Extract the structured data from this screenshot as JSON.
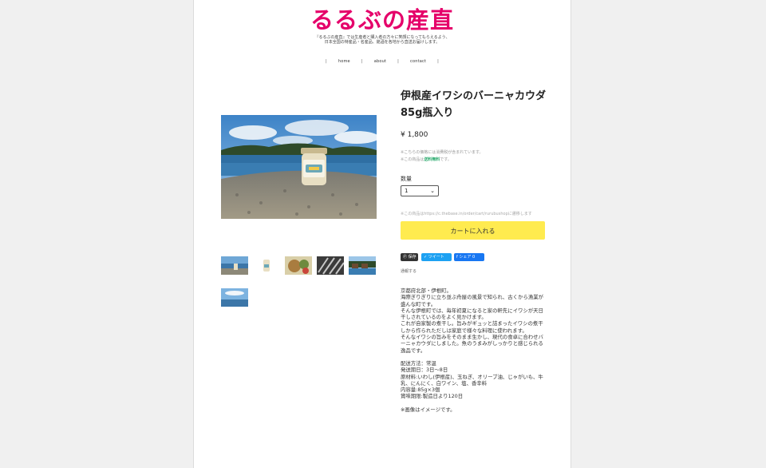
{
  "header": {
    "logo_part1": "るるぶ",
    "logo_part2": "の産直",
    "tagline_line1": "『るるぶの産直』では生産者と購入者の方々に笑顔になってもらえるよう、",
    "tagline_line2": "日本全国の特産品・名産品、銘酒を各地から直送お届けします。"
  },
  "nav": {
    "sep": "|",
    "items": [
      "home",
      "about",
      "contact"
    ]
  },
  "product": {
    "title": "伊根産イワシのバーニャカウダ　85g瓶入り",
    "price": "¥ 1,800",
    "note_tax": "※こちらの価格には消費税が含まれています。",
    "note_ship_prefix": "※この商品は",
    "note_ship_highlight": "送料無料",
    "note_ship_suffix": "です。",
    "qty_label": "数量",
    "qty_value": "1",
    "url_note": "※この商品はhttps://c.thebase.in/order/cart/rurubushopに遷移します",
    "cart_label": "カートに入れる",
    "share": {
      "save": "保存",
      "tweet": "ツイート",
      "fb": "シェア 0"
    },
    "report_label": "通報する",
    "description_lines": [
      "京都府北部・伊根町。",
      "海際ぎりぎりに立ち並ぶ舟屋の風景で知られ、古くから漁業が盛んな町です。",
      "そんな伊根町では、毎年初夏になると家の軒先にイワシが天日干しされているのをよく見かけます。",
      "これが自家製の煮干し。旨みがギュッと詰まったイワシの煮干しから作られただしは家庭で様々な料理に使われます。",
      "そんなイワシの旨みをそのまま生かし、現代の食卓に合わせバーニャカウダにしました。魚のうまみがしっかりと感じられる逸品です。"
    ],
    "spec_lines": [
      "配送方法：常温",
      "発送期日：3日〜8日",
      "原材料:いわし(伊根産)、玉ねぎ、オリーブ油、じゃがいも、牛乳、にんにく、白ワイン、塩、香辛料",
      "内容量:85g×3個",
      "賞味期限:製造日より120日"
    ],
    "image_note": "※画像はイメージです。"
  },
  "colors": {
    "logo_pink": "#e5006a",
    "cart_yellow": "#ffeb4f",
    "ship_green": "#27a86b",
    "twitter_blue": "#1da1f2",
    "fb_blue": "#1877f2"
  }
}
